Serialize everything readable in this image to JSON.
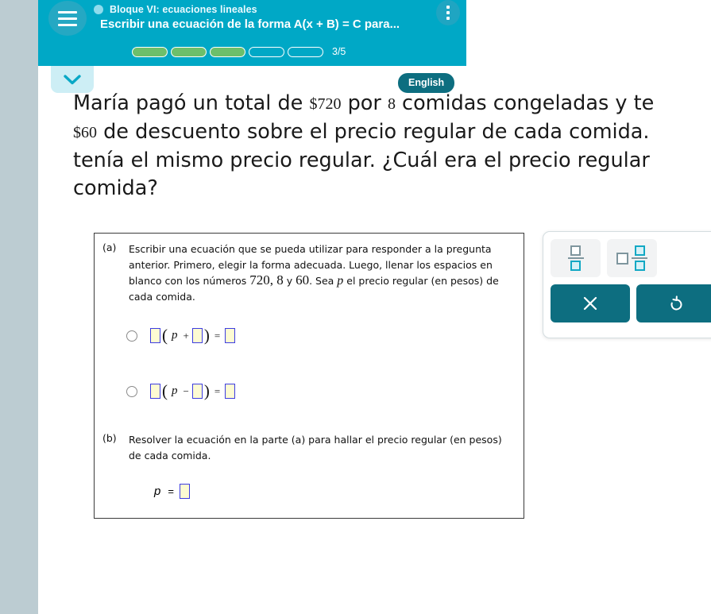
{
  "header": {
    "module_label": "Bloque VI: ecuaciones lineales",
    "lesson_title": "Escribir una ecuación de la forma A(x + B) = C para...",
    "progress_text": "3/5",
    "progress_total": 5,
    "progress_filled": 3,
    "teal": "#00a8c6",
    "progress_fill_color": "#6cbf6b"
  },
  "language_button": {
    "label": "English"
  },
  "prompt": {
    "lines": [
      {
        "pre": "María pagó un total de ",
        "num1": "$720",
        "mid": " por ",
        "num2": "8",
        "post": " comidas congeladas y te"
      },
      {
        "pre": "",
        "num1": "$60",
        "mid": "",
        "num2": "",
        "post": " de descuento sobre el precio regular de cada comida."
      },
      {
        "pre": "tenía el mismo precio regular. ¿Cuál era el precio regular",
        "num1": "",
        "mid": "",
        "num2": "",
        "post": ""
      },
      {
        "pre": "comida?",
        "num1": "",
        "mid": "",
        "num2": "",
        "post": ""
      }
    ],
    "line1_pre": "María pagó un total de ",
    "line1_n1": "$720",
    "line1_mid": " por ",
    "line1_n2": "8",
    "line1_post": " comidas congeladas y te",
    "line2_n1": "$60",
    "line2_post": " de descuento sobre el precio regular de cada comida.",
    "line3": "tenía el mismo precio regular. ¿Cuál era el precio regular",
    "line4": "comida?"
  },
  "work": {
    "part_a": {
      "label": "(a)",
      "text_1": "Escribir una ecuación que se pueda utilizar para responder a la pregunta anterior. Primero, elegir la forma adecuada. Luego, llenar los espacios en blanco con los números ",
      "numbers": "720, 8",
      "conj": " y ",
      "number3": "60",
      "text_2": ". Sea ",
      "variable": "p",
      "text_3": " el precio regular (en pesos) de cada comida."
    },
    "choices": [
      {
        "variable": "p",
        "operator": "+",
        "equals": "="
      },
      {
        "variable": "p",
        "operator": "−",
        "equals": "="
      }
    ],
    "part_b": {
      "label": "(b)",
      "text": "Resolver la ecuación en la parte (a) para hallar el precio regular (en pesos) de cada comida.",
      "variable": "p",
      "equals": "="
    }
  },
  "keypad": {
    "fraction_tool": "fraction",
    "mixed_number_tool": "mixed-number",
    "clear_label": "×",
    "undo_label": "↺",
    "button_color": "#0d6e80"
  }
}
